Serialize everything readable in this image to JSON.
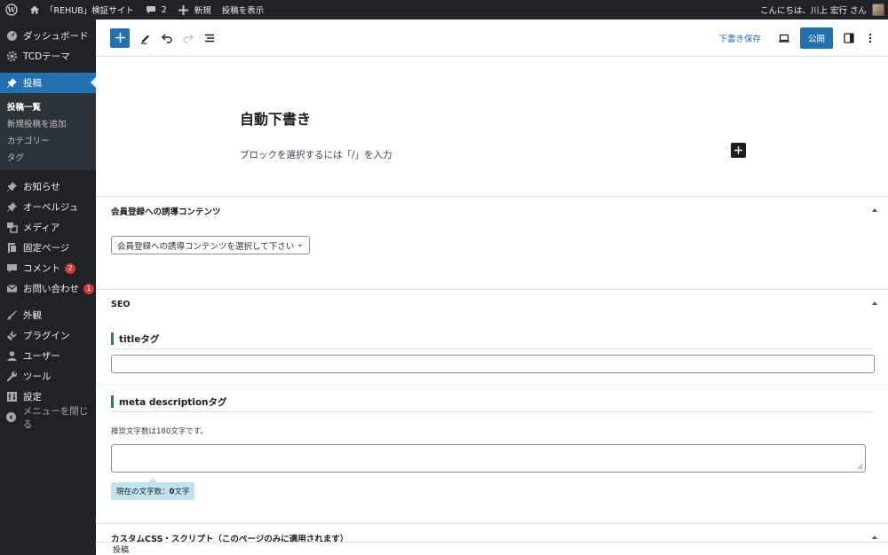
{
  "admin_bar": {
    "site_name": "「REHUB」検証サイト",
    "comments_count": "2",
    "new_label": "新規",
    "view_post_label": "投稿を表示",
    "greeting": "こんにちは、川上 宏行 さん"
  },
  "sidebar": {
    "dashboard": "ダッシュボード",
    "tcd_theme": "TCDテーマ",
    "posts": "投稿",
    "posts_sub": [
      "投稿一覧",
      "新規投稿を追加",
      "カテゴリー",
      "タグ"
    ],
    "news": "お知らせ",
    "auberge": "オーベルジュ",
    "media": "メディア",
    "pages": "固定ページ",
    "comments": "コメント",
    "comments_badge": "2",
    "contact": "お問い合わせ",
    "contact_badge": "1",
    "appearance": "外観",
    "plugins": "プラグイン",
    "users": "ユーザー",
    "tools": "ツール",
    "settings": "設定",
    "collapse": "メニューを閉じる"
  },
  "header": {
    "save_draft": "下書き保存",
    "publish": "公開"
  },
  "editor": {
    "title": "自動下書き",
    "placeholder": "ブロックを選択するには「/」を入力"
  },
  "metabox_membership": {
    "title": "会員登録への誘導コンテンツ",
    "select_value": "会員登録への誘導コンテンツを選択して下さい"
  },
  "metabox_seo": {
    "title": "SEO",
    "title_tag_label": "titleタグ",
    "meta_desc_label": "meta descriptionタグ",
    "hint": "推奨文字数は180文字です。",
    "counter_prefix": "現在の文字数：",
    "counter_value": "0",
    "counter_suffix": "文字"
  },
  "metabox_custom": {
    "title": "カスタムCSS・スクリプト（このページのみに適用されます）"
  },
  "footer": {
    "breadcrumb": "投稿"
  },
  "colors": {
    "admin_dark": "#1d2327",
    "accent": "#2271b1",
    "badge": "#d63638",
    "counter_bg": "#bfe3ef"
  }
}
